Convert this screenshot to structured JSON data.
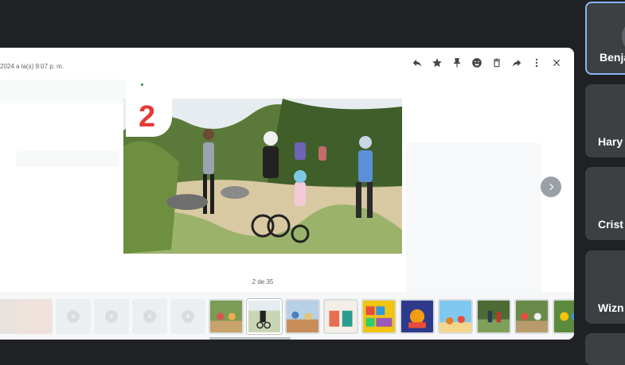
{
  "viewer": {
    "timestamp": "2024 a la(s) 9:07 p. m.",
    "counter": "2 de 35",
    "slide_number": "2",
    "toolbar": [
      {
        "name": "reply-icon"
      },
      {
        "name": "star-icon"
      },
      {
        "name": "pin-icon"
      },
      {
        "name": "emoji-icon"
      },
      {
        "name": "trash-icon"
      },
      {
        "name": "forward-icon"
      },
      {
        "name": "more-vert-icon"
      },
      {
        "name": "close-icon"
      }
    ]
  },
  "participants": [
    {
      "name": "Benja",
      "active": true
    },
    {
      "name": "Hary",
      "active": false
    },
    {
      "name": "Crist",
      "active": false
    },
    {
      "name": "Wizn",
      "active": false
    }
  ],
  "colors": {
    "page_bg": "#202124",
    "tile_bg": "#3c4043",
    "active_border": "#8ab4f8",
    "slide_number": "#e53935"
  }
}
